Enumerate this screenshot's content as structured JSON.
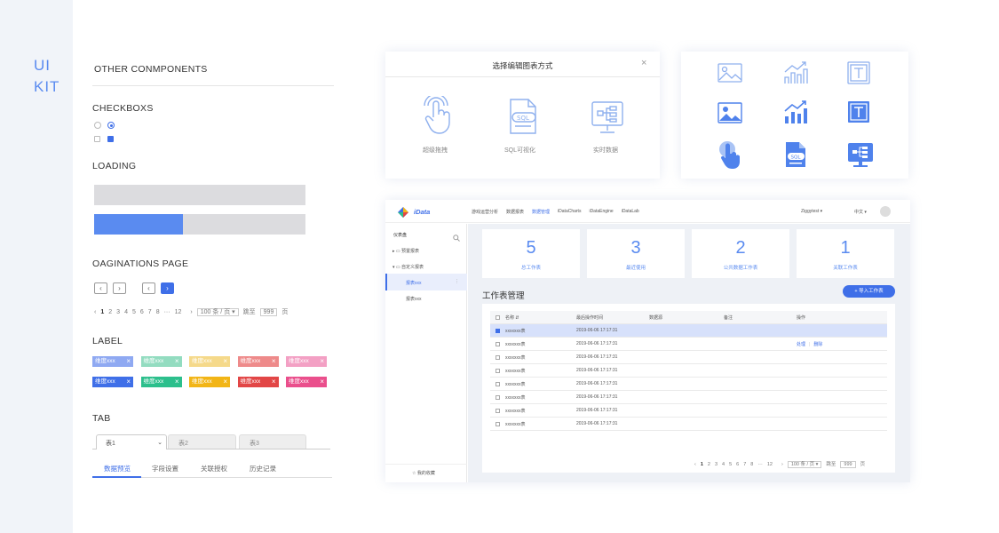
{
  "kit": {
    "line1": "UI",
    "line2": "KIT"
  },
  "left": {
    "section_title": "OTHER CONMPONENTS",
    "checkboxes_title": "CHECKBOXS",
    "loading_title": "LOADING",
    "loading_progress": 0.42,
    "pagination_title": "OAGINATIONS PAGE",
    "pagination": {
      "prev": "‹",
      "next": "›",
      "pages": [
        "1",
        "2",
        "3",
        "4",
        "5",
        "6",
        "7",
        "8",
        "···",
        "12"
      ],
      "active": "1",
      "size": "100 条 / 页 ▾",
      "jump_label": "跳至",
      "jump_value": "999",
      "jump_unit": "页"
    },
    "label_title": "LABEL",
    "tag_text": "维度xxx",
    "tag_colors_light": [
      "#8fa9f2",
      "#93dcc0",
      "#f5d98a",
      "#ee8a8a",
      "#f3a0c4"
    ],
    "tag_colors_dark": [
      "#3f6fe8",
      "#2cbf8c",
      "#f2b516",
      "#e24646",
      "#ea4f8c"
    ],
    "tab_title": "TAB",
    "tabs": [
      {
        "label": "表1",
        "arrow": "⌄"
      },
      {
        "label": "表2"
      },
      {
        "label": "表3"
      }
    ],
    "subtabs": [
      "数据预览",
      "字段设置",
      "关联授权",
      "历史记录"
    ]
  },
  "dialog": {
    "title": "选择编辑图表方式",
    "close": "×",
    "options": [
      {
        "label": "超级拖拽",
        "icon": "hand-pointer-icon"
      },
      {
        "label": "SQL可视化",
        "icon": "sql-file-icon"
      },
      {
        "label": "实时数据",
        "icon": "monitor-flow-icon"
      }
    ]
  },
  "icon_grid": [
    "image-outline-icon",
    "chart-outline-icon",
    "text-outline-icon",
    "image-fill-icon",
    "chart-fill-icon",
    "text-fill-icon",
    "hand-fill-icon",
    "sql-fill-icon",
    "monitor-fill-icon"
  ],
  "app": {
    "logo": "iData",
    "nav": [
      "游戏运营分析",
      "数据报表",
      "数据管理",
      "iDataCharts",
      "iDataEngine",
      "iDataLab"
    ],
    "nav_active": 2,
    "user": "Ziggytest ▾",
    "lang": "中文 ▾",
    "sidebar_title": "仪表盘",
    "tree": [
      {
        "label": "预置报表",
        "arrow": "▸"
      },
      {
        "label": "自定义报表",
        "arrow": "▾"
      },
      {
        "label": "报表xxx",
        "selected": true,
        "more": "⋮"
      },
      {
        "label": "报表xxx"
      }
    ],
    "favorites": "☆ 我的收藏",
    "stats": [
      {
        "num": "5",
        "label": "总工作表"
      },
      {
        "num": "3",
        "label": "最近使用"
      },
      {
        "num": "2",
        "label": "公共数据工作表"
      },
      {
        "num": "1",
        "label": "关联工作表"
      }
    ],
    "section_title": "工作表管理",
    "import_btn": "+ 导入工作表",
    "columns": [
      "名称 ⇵",
      "最后操作时间",
      "数据源",
      "备注",
      "操作"
    ],
    "rows": [
      {
        "name": "xxxxxxx表",
        "time": "2019-06-06 17:17:31",
        "checked": true,
        "selected": true
      },
      {
        "name": "xxxxxxx表",
        "time": "2019-06-06 17:17:31",
        "actions": [
          "处理",
          "删除"
        ]
      },
      {
        "name": "xxxxxxx表",
        "time": "2019-06-06 17:17:31"
      },
      {
        "name": "xxxxxxx表",
        "time": "2019-06-06 17:17:31"
      },
      {
        "name": "xxxxxxx表",
        "time": "2019-06-06 17:17:31"
      },
      {
        "name": "xxxxxxx表",
        "time": "2019-06-06 17:17:31"
      },
      {
        "name": "xxxxxxx表",
        "time": "2019-06-06 17:17:31"
      },
      {
        "name": "xxxxxxx表",
        "time": "2019-06-06 17:17:31"
      }
    ],
    "pagination": {
      "prev": "‹",
      "next": "›",
      "pages": [
        "1",
        "2",
        "3",
        "4",
        "5",
        "6",
        "7",
        "8",
        "···",
        "12"
      ],
      "active": "1",
      "size": "100 条 / 页 ▾",
      "jump_label": "跳至",
      "jump_value": "999",
      "jump_unit": "页"
    }
  },
  "colors": {
    "accent": "#3f6fe8",
    "icon_light": "#8fb0ee",
    "icon_fill": "#4f82ec"
  }
}
